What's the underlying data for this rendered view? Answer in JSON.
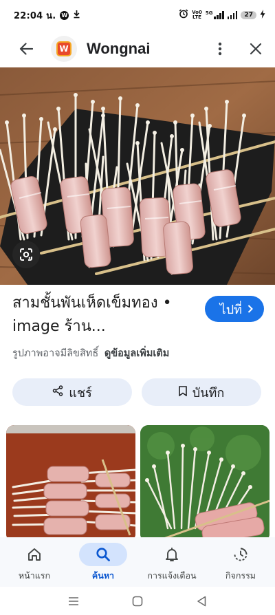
{
  "status_bar": {
    "time": "22:04 น.",
    "volte": "Vo0",
    "lte": "LTE",
    "network": "5G",
    "battery": "27"
  },
  "app_header": {
    "title": "Wongnai",
    "logo_letter": "W"
  },
  "result": {
    "title": "สามชั้นพันเห็ดเข็มทอง • image ร้าน...",
    "visit_label": "ไปที่",
    "copyright_note": "รูปภาพอาจมีลิขสิทธิ์",
    "more_info_label": "ดูข้อมูลเพิ่มเติม"
  },
  "actions": {
    "share_label": "แชร์",
    "save_label": "บันทึก"
  },
  "bottom_nav": {
    "items": [
      {
        "label": "หน้าแรก",
        "icon": "home-icon"
      },
      {
        "label": "ค้นหา",
        "icon": "search-icon"
      },
      {
        "label": "การแจ้งเตือน",
        "icon": "bell-icon"
      },
      {
        "label": "กิจกรรม",
        "icon": "activity-icon"
      }
    ],
    "active_index": 1
  },
  "colors": {
    "accent": "#1a73e8",
    "pill_bg": "#e8eef9",
    "nav_active_bg": "#d3e3fd",
    "wongnai_brand": "#e8492b"
  }
}
